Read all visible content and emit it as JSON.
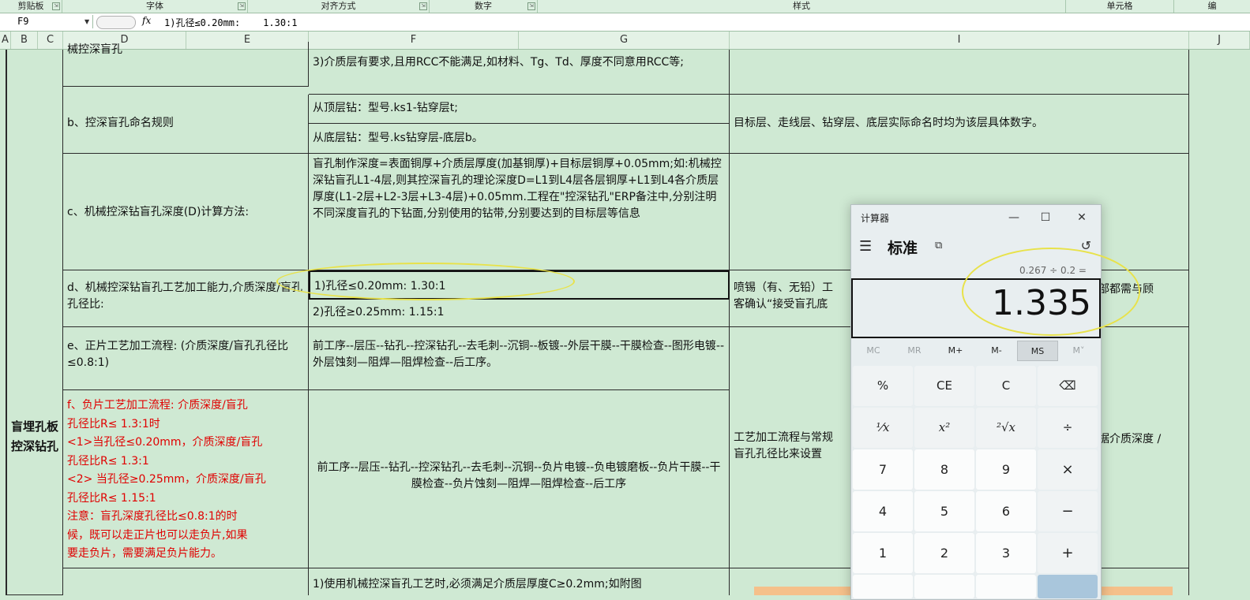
{
  "ribbon": {
    "groups": [
      "剪贴板",
      "字体",
      "对齐方式",
      "数字",
      "样式",
      "单元格",
      "编"
    ]
  },
  "formula_bar": {
    "name_box": "F9",
    "fx": "fx",
    "content": "1)孔径≤0.20mm:    1.30:1"
  },
  "columns": [
    "A",
    "B",
    "C",
    "D",
    "E",
    "F",
    "G",
    "I",
    "J"
  ],
  "sheet": {
    "b_merged": "盲埋孔板控深钻孔",
    "row_top": {
      "d": "械控深盲孔",
      "f": "3)介质层有要求,且用RCC不能满足,如材料、Tg、Td、厚度不同意用RCC等;"
    },
    "row_b": {
      "d": "b、控深盲孔命名规则",
      "f1": "从顶层钻：型号.ks1-钻穿层t;",
      "f2": "从底层钻：型号.ks钻穿层-底层b。",
      "i": "目标层、走线层、钻穿层、底层实际命名时均为该层具体数字。"
    },
    "row_c": {
      "d": "c、机械控深钻盲孔深度(D)计算方法:",
      "f": "盲孔制作深度=表面铜厚+介质层厚度(加基铜厚)+目标层铜厚+0.05mm;如:机械控深钻盲孔L1-4层,则其控深盲孔的理论深度D=L1到L4层各层铜厚+L1到L4各介质层厚度(L1-2层+L2-3层+L3-4层)+0.05mm.工程在\"控深钻孔\"ERP备注中,分别注明不同深度盲孔的下钻面,分别使用的钻带,分别要达到的目标层等信息"
    },
    "row_d": {
      "d": "d、机械控深钻盲孔工艺加工能力,介质深度/盲孔孔径比:",
      "f1": "1)孔径≤0.20mm:    1.30:1",
      "f2": "2)孔径≥0.25mm:    1.15:1",
      "i": "喷锡（有、无铅）工艺的控深盲孔板，市场部都需与顾客确认“接受盲孔底部",
      "i_left": "喷锡（有、无铅）工",
      "i_right": "部都需与顾",
      "i_line2": "客确认“接受盲孔底"
    },
    "row_e": {
      "d": "e、正片工艺加工流程: (介质深度/盲孔孔径比≤0.8:1)",
      "f": "前工序--层压--钻孔--控深钻孔--去毛刺--沉铜--板镀--外层干膜--干膜检查--图形电镀--外层蚀刻—阻焊—阻焊检查--后工序。"
    },
    "row_f": {
      "d_lines": [
        "f、负片工艺加工流程: 介质深度/盲孔",
        "孔径比R≤ 1.3:1时",
        "<1>当孔径≤0.20mm，介质深度/盲孔",
        "孔径比R≤ 1.3:1",
        "<2> 当孔径≥0.25mm，介质深度/盲孔",
        "孔径比R≤ 1.15:1",
        "注意：盲孔深度孔径比≤0.8:1的时",
        "候，既可以走正片也可以走负片,如果",
        "要走负片，需要满足负片能力。"
      ],
      "f": "前工序--层压--钻孔--控深钻孔--去毛刺--沉铜--负片电镀--负电镀磨板--负片干膜--干膜检查--负片蚀刻—阻焊—阻焊检查--后工序",
      "i_left": "工艺加工流程与常规",
      "i_right": "据介质深度 /",
      "i_line2": "盲孔孔径比来设置"
    },
    "row_last": {
      "f": "1)使用机械控深盲孔工艺时,必须满足介质层厚度C≥0.2mm;如附图"
    }
  },
  "calculator": {
    "title": "计算器",
    "mode": "标准",
    "expression": "0.267 ÷ 0.2 =",
    "result": "1.335",
    "memory": [
      "MC",
      "MR",
      "M+",
      "M-",
      "MS",
      "M˅"
    ],
    "keys": [
      [
        "%",
        "CE",
        "C",
        "⌫"
      ],
      [
        "¹⁄x",
        "x²",
        "²√x",
        "÷"
      ],
      [
        "7",
        "8",
        "9",
        "×"
      ],
      [
        "4",
        "5",
        "6",
        "−"
      ],
      [
        "1",
        "2",
        "3",
        "+"
      ]
    ]
  },
  "colors": {
    "sheet_bg": "#cfe9d3",
    "highlight": "#e8e24a",
    "red_text": "#e00000"
  }
}
